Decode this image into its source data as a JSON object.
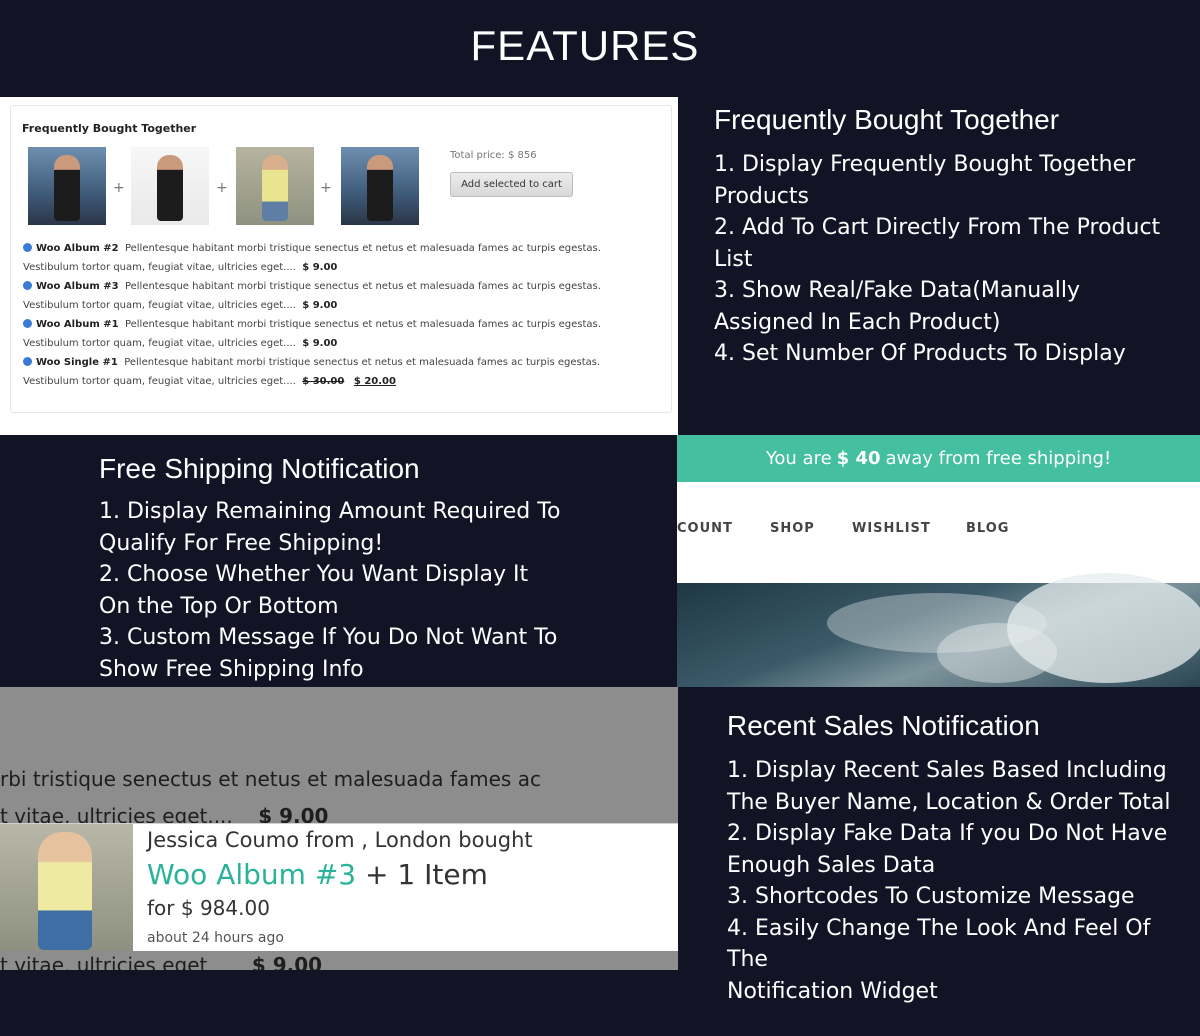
{
  "page": {
    "title": "FEATURES"
  },
  "fbt": {
    "heading": "Frequently Bought Together",
    "total": "Total price: $ 856",
    "add_button": "Add selected to cart",
    "items": [
      {
        "name": "Woo Album #2",
        "desc": "Pellentesque habitant morbi tristique senectus et netus et malesuada fames ac turpis egestas.",
        "desc2": "Vestibulum tortor quam, feugiat vitae, ultricies eget....",
        "price": "$ 9.00",
        "old_price": ""
      },
      {
        "name": "Woo Album #3",
        "desc": "Pellentesque habitant morbi tristique senectus et netus et malesuada fames ac turpis egestas.",
        "desc2": "Vestibulum tortor quam, feugiat vitae, ultricies eget....",
        "price": "$ 9.00",
        "old_price": ""
      },
      {
        "name": "Woo Album #1",
        "desc": "Pellentesque habitant morbi tristique senectus et netus et malesuada fames ac turpis egestas.",
        "desc2": "Vestibulum tortor quam, feugiat vitae, ultricies eget....",
        "price": "$ 9.00",
        "old_price": ""
      },
      {
        "name": "Woo Single #1",
        "desc": "Pellentesque habitant morbi tristique senectus et netus et malesuada fames ac turpis egestas.",
        "desc2": "Vestibulum tortor quam, feugiat vitae, ultricies eget....",
        "price": "$ 20.00",
        "old_price": "$ 30.00"
      }
    ],
    "plus_sign": "+"
  },
  "section1": {
    "title": "Frequently Bought Together",
    "lines": [
      "1. Display Frequently Bought Together",
      "Products",
      "2. Add To Cart Directly From The Product",
      "List",
      "3. Show Real/Fake Data(Manually",
      "Assigned In Each Product)",
      "4. Set Number Of Products To Display"
    ]
  },
  "section2": {
    "title": "Free Shipping Notification",
    "lines": [
      "1. Display Remaining Amount Required To",
      "Qualify For Free Shipping!",
      "2. Choose Whether You Want Display It",
      "On the Top Or Bottom",
      "3. Custom Message If You Do Not Want To",
      "Show Free Shipping Info"
    ]
  },
  "shipping": {
    "bar_prefix": "You are ",
    "bar_amount": "$ 40",
    "bar_suffix": " away from free shipping!",
    "nav": [
      "COUNT",
      "SHOP",
      "WISHLIST",
      "BLOG"
    ]
  },
  "section3": {
    "title": "Recent Sales Notification",
    "lines": [
      "1. Display Recent Sales Based Including",
      "The Buyer Name, Location & Order Total",
      "2. Display Fake Data If you Do Not Have",
      "Enough Sales Data",
      "3. Shortcodes To Customize Message",
      "4. Easily Change The Look And Feel Of The",
      "Notification Widget"
    ]
  },
  "sales": {
    "bg_line1": "rbi tristique senectus et netus et malesuada fames ac",
    "bg_line2": "t vitae, ultricies eget....",
    "bg_price": "$ 9.00",
    "bg_line3": "t vitae, ultricies eget",
    "bg_price2": "$ 9.00",
    "buyer": "Jessica Coumo from , London bought",
    "product": "Woo Album #3",
    "extra": " + 1 Item",
    "total": "for $ 984.00",
    "time": "about 24 hours ago",
    "accent": "#2bb39a"
  }
}
